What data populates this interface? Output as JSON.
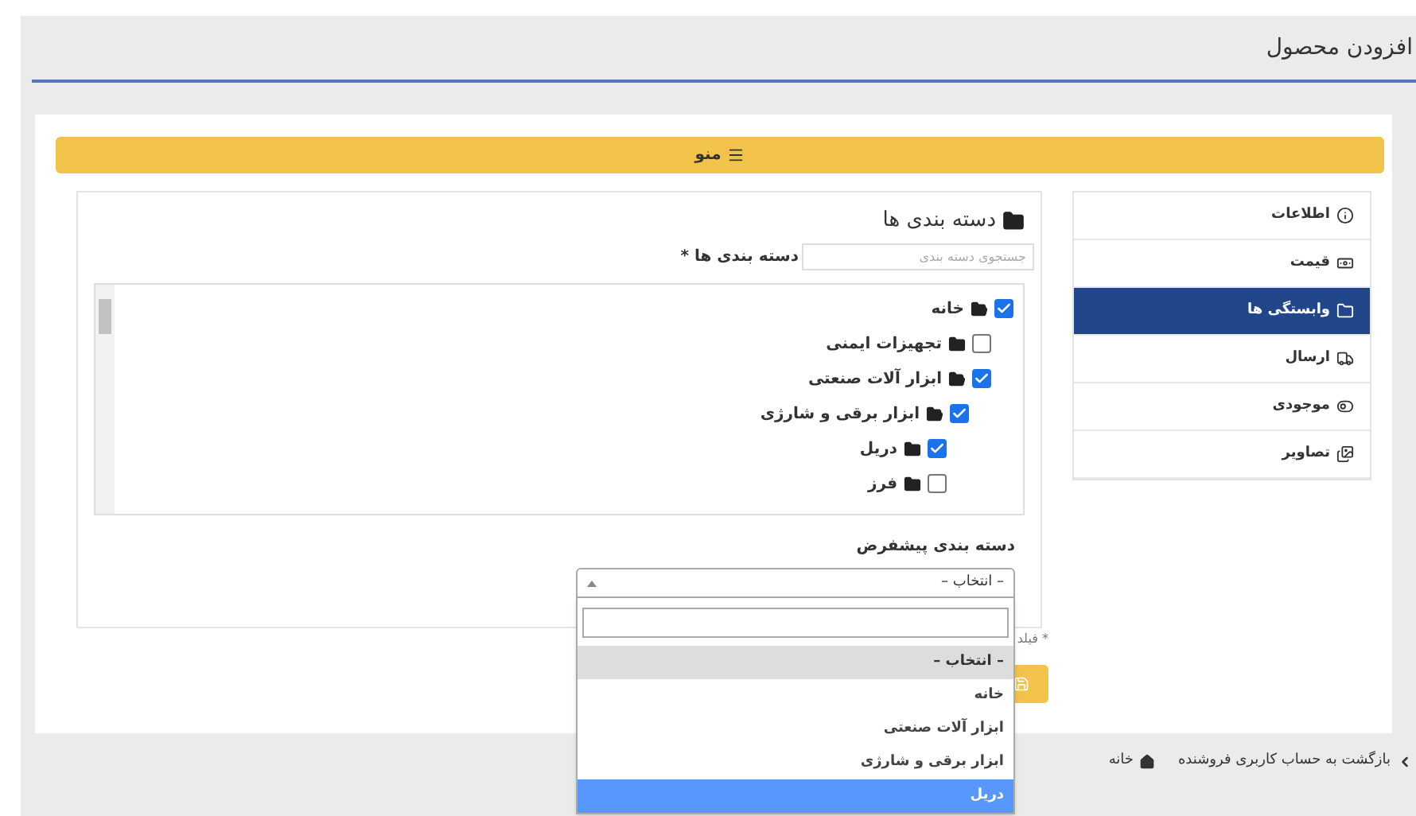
{
  "page_title": "افزودن محصول",
  "menu_bar": {
    "label": "منو"
  },
  "tabs": [
    {
      "label": "اطلاعات",
      "kind": "info",
      "selected": false
    },
    {
      "label": "قیمت",
      "kind": "price",
      "selected": false
    },
    {
      "label": "وابستگی ها",
      "kind": "relations",
      "selected": true
    },
    {
      "label": "ارسال",
      "kind": "shipping",
      "selected": false
    },
    {
      "label": "موجودی",
      "kind": "stock",
      "selected": false
    },
    {
      "label": "تصاویر",
      "kind": "images",
      "selected": false
    }
  ],
  "categories_panel": {
    "heading": "دسته بندی ها",
    "field_label": "دسته بندی ها *",
    "search_placeholder": "جستجوی دسته بندی",
    "tree": [
      {
        "label": "خانه",
        "checked": true,
        "children": [
          {
            "label": "تجهیزات ایمنی",
            "checked": false
          },
          {
            "label": "ابزار آلات صنعتی",
            "checked": true,
            "children": [
              {
                "label": "ابزار برقی و شارژی",
                "checked": true,
                "children": [
                  {
                    "label": "دریل",
                    "checked": true
                  },
                  {
                    "label": "فرز",
                    "checked": false
                  }
                ]
              }
            ]
          }
        ]
      }
    ],
    "default_category": {
      "label": "دسته بندی پیشفرض",
      "value": "– انتخاب –",
      "expanded": true,
      "options": [
        {
          "label": "– انتخاب –",
          "selected": true,
          "highlighted": false
        },
        {
          "label": "خانه",
          "selected": false,
          "highlighted": false
        },
        {
          "label": "ابزار آلات صنعتی",
          "selected": false,
          "highlighted": false
        },
        {
          "label": "ابزار برقی و شارژی",
          "selected": false,
          "highlighted": false
        },
        {
          "label": "دریل",
          "selected": false,
          "highlighted": true
        }
      ]
    }
  },
  "required_note": "* فیلد",
  "breadcrumb": [
    {
      "label": "بازگشت به حساب کاربری فروشنده",
      "kind": "back"
    },
    {
      "label": "خانه",
      "kind": "home"
    }
  ]
}
